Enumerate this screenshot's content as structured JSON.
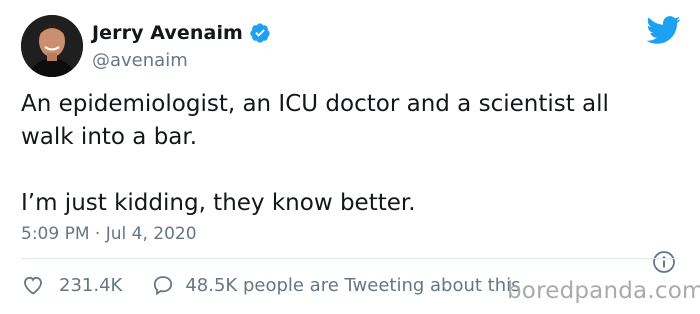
{
  "author": {
    "display_name": "Jerry Avenaim",
    "handle": "@avenaim",
    "verified": true
  },
  "tweet": {
    "line1": "An epidemiologist, an ICU doctor and a scientist all",
    "line2": "walk into a bar.",
    "line3": "I’m just kidding, they know better."
  },
  "meta": {
    "timestamp": "5:09 PM · Jul 4, 2020"
  },
  "stats": {
    "likes": "231.4K",
    "tweeting": "48.5K people are Tweeting about this"
  },
  "watermark": "boredpanda.com",
  "colors": {
    "twitter_blue": "#1da1f2",
    "text_primary": "#14171a",
    "text_secondary": "#657786"
  },
  "icons": [
    "verified-badge-icon",
    "twitter-bird-icon",
    "info-icon",
    "heart-icon",
    "comment-icon"
  ]
}
